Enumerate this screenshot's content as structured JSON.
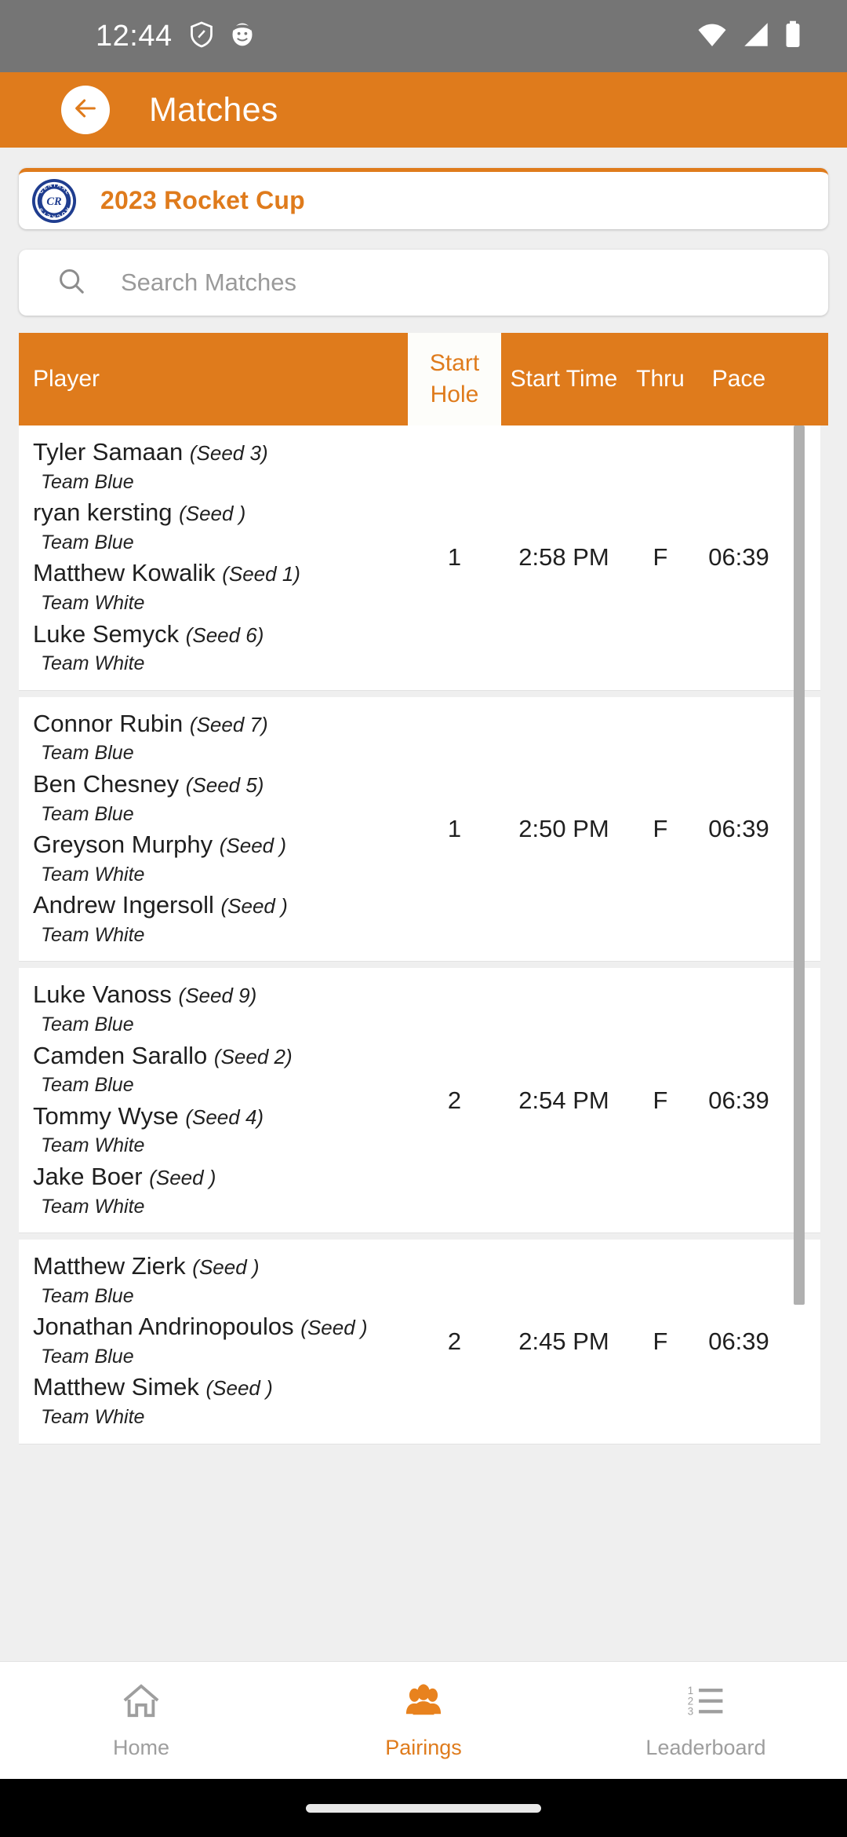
{
  "status_bar": {
    "time": "12:44",
    "icons": [
      "shield-icon",
      "face-icon",
      "wifi-icon",
      "cell-signal-icon",
      "battery-icon"
    ]
  },
  "app_bar": {
    "back_icon": "arrow-left-icon",
    "title": "Matches"
  },
  "tournament": {
    "logo_alt": "central-rockets-logo",
    "name": "2023 Rocket Cup",
    "logo_top_text": "CENTRAL",
    "logo_bottom_text": "ROCKETS",
    "logo_monogram": "CR"
  },
  "search": {
    "icon": "search-icon",
    "placeholder": "Search Matches",
    "value": ""
  },
  "table": {
    "columns": {
      "player": "Player",
      "start_hole_line1": "Start",
      "start_hole_line2": "Hole",
      "start_time": "Start Time",
      "thru": "Thru",
      "pace": "Pace"
    },
    "rows": [
      {
        "players": [
          {
            "name": "Tyler Samaan",
            "seed": "(Seed 3)",
            "team": "Team Blue"
          },
          {
            "name": "ryan kersting",
            "seed": "(Seed )",
            "team": "Team Blue"
          },
          {
            "name": "Matthew Kowalik",
            "seed": "(Seed 1)",
            "team": "Team White"
          },
          {
            "name": "Luke Semyck",
            "seed": "(Seed 6)",
            "team": "Team White"
          }
        ],
        "start_hole": "1",
        "start_time": "2:58 PM",
        "thru": "F",
        "pace": "06:39"
      },
      {
        "players": [
          {
            "name": "Connor Rubin",
            "seed": "(Seed 7)",
            "team": "Team Blue"
          },
          {
            "name": "Ben Chesney",
            "seed": "(Seed 5)",
            "team": "Team Blue"
          },
          {
            "name": "Greyson Murphy",
            "seed": "(Seed )",
            "team": "Team White"
          },
          {
            "name": "Andrew Ingersoll",
            "seed": "(Seed )",
            "team": "Team White"
          }
        ],
        "start_hole": "1",
        "start_time": "2:50 PM",
        "thru": "F",
        "pace": "06:39"
      },
      {
        "players": [
          {
            "name": "Luke Vanoss",
            "seed": "(Seed 9)",
            "team": "Team Blue"
          },
          {
            "name": "Camden Sarallo",
            "seed": "(Seed 2)",
            "team": "Team Blue"
          },
          {
            "name": "Tommy Wyse",
            "seed": "(Seed 4)",
            "team": "Team White"
          },
          {
            "name": "Jake Boer",
            "seed": "(Seed )",
            "team": "Team White"
          }
        ],
        "start_hole": "2",
        "start_time": "2:54 PM",
        "thru": "F",
        "pace": "06:39"
      },
      {
        "players": [
          {
            "name": "Matthew Zierk",
            "seed": "(Seed )",
            "team": "Team Blue"
          },
          {
            "name": "Jonathan Andrinopoulos",
            "seed": "(Seed )",
            "team": "Team Blue"
          },
          {
            "name": "Matthew Simek",
            "seed": "(Seed )",
            "team": "Team White"
          },
          {
            "name": "",
            "seed": "",
            "team": ""
          }
        ],
        "start_hole": "2",
        "start_time": "2:45 PM",
        "thru": "F",
        "pace": "06:39"
      }
    ]
  },
  "bottom_nav": {
    "items": [
      {
        "label": "Home",
        "icon": "home-icon",
        "active": false
      },
      {
        "label": "Pairings",
        "icon": "people-group-icon",
        "active": true
      },
      {
        "label": "Leaderboard",
        "icon": "numbered-list-icon",
        "active": false
      }
    ]
  },
  "colors": {
    "accent": "#df7b1c",
    "status_bar": "#757575",
    "page_bg": "#efefef",
    "inactive": "#9e9e9e"
  }
}
